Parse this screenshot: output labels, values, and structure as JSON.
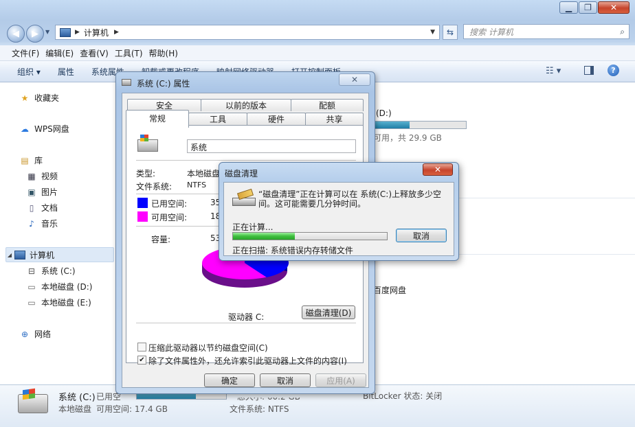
{
  "address": {
    "computer": "计算机"
  },
  "search": {
    "placeholder": "搜索 计算机"
  },
  "menu": [
    "文件(F)",
    "编辑(E)",
    "查看(V)",
    "工具(T)",
    "帮助(H)"
  ],
  "commands": {
    "organize": "组织",
    "properties": "属性",
    "system_properties": "系统属性",
    "uninstall": "卸载或更改程序",
    "map_drive": "映射网络驱动器",
    "control_panel": "打开控制面板"
  },
  "sidebar": {
    "favorites": "收藏夹",
    "wps": "WPS网盘",
    "library": "库",
    "libs": [
      "视频",
      "图片",
      "文档",
      "音乐"
    ],
    "computer": "计算机",
    "drives": [
      "系统 (C:)",
      "本地磁盘 (D:)",
      "本地磁盘 (E:)"
    ],
    "network": "网络"
  },
  "content": {
    "drive_d_title": "(D:)",
    "drive_d_usage": 0.4,
    "drive_d_space": "可用，共 29.9 GB",
    "baidu": "百度网盘"
  },
  "details": {
    "name": "系统 (C:)",
    "used_label": "已用空",
    "type": "本地磁盘",
    "free": "可用空间: 17.4 GB",
    "total_partial": "总大小: 60.2 GB",
    "filesystem": "文件系统: NTFS",
    "bitlocker": "BitLocker 状态: 关闭"
  },
  "props": {
    "title": "系统 (C:) 属性",
    "tabs_top": [
      "安全",
      "以前的版本",
      "配额"
    ],
    "tabs_bottom": [
      "常规",
      "工具",
      "硬件",
      "共享"
    ],
    "volume_name": "系统",
    "type_label": "类型:",
    "type_value": "本地磁盘",
    "fs_label": "文件系统:",
    "fs_value": "NTFS",
    "used_label": "已用空间:",
    "used_value": "35",
    "free_label": "可用空间:",
    "free_value": "18",
    "capacity_label": "容量:",
    "capacity_value": "53",
    "used_color": "#0000ff",
    "free_color": "#ff00ff",
    "drive_label": "驱动器 C:",
    "cleanup_btn": "磁盘清理(D)",
    "compress": "压缩此驱动器以节约磁盘空间(C)",
    "index": "除了文件属性外，还允许索引此驱动器上文件的内容(I)",
    "index_checked": true,
    "compress_checked": false,
    "ok": "确定",
    "cancel": "取消",
    "apply": "应用(A)"
  },
  "cleanup": {
    "title": "磁盘清理",
    "message": "“磁盘清理”正在计算可以在 系统(C:)上释放多少空间。这可能需要几分钟时间。",
    "calculating": "正在计算...",
    "cancel": "取消",
    "progress": 0.4,
    "scanning": "正在扫描:  系统错误内存转储文件"
  }
}
